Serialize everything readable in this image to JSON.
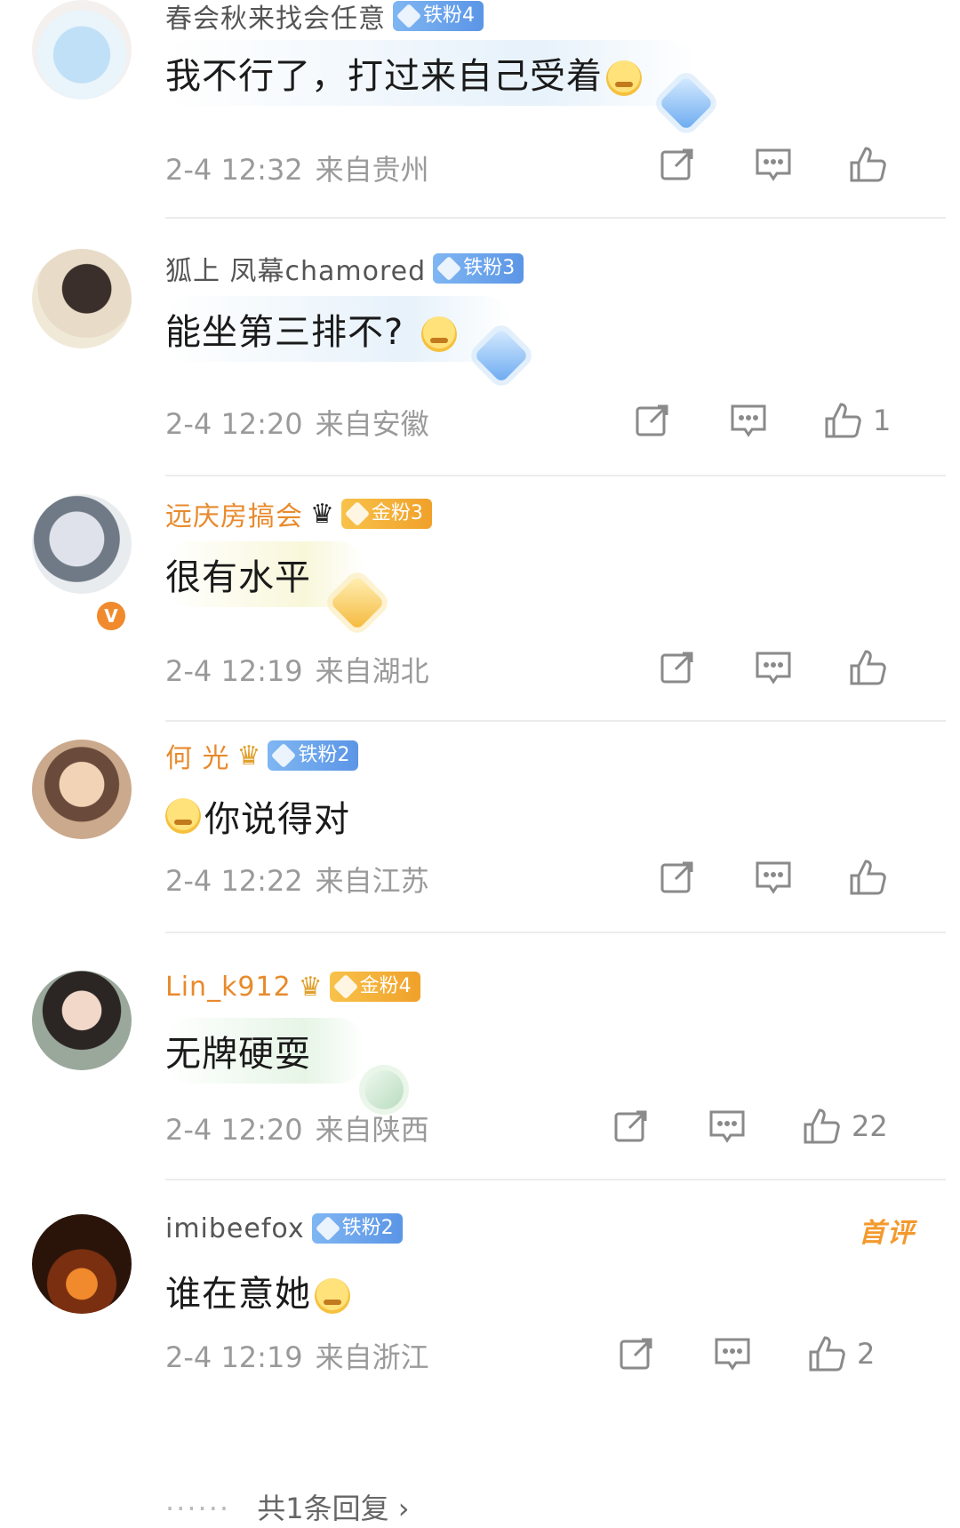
{
  "comments": [
    {
      "username": "春会秋来找会任意",
      "badge": "铁粉4",
      "text": "我不行了，打过来自己受着",
      "date": "2-4 12:32",
      "location": "来自贵州",
      "likes": ""
    },
    {
      "username": "狐上 凤幕chamored",
      "badge": "铁粉3",
      "text": "能坐第三排不?",
      "date": "2-4 12:20",
      "location": "来自安徽",
      "likes": "1"
    },
    {
      "username": "远庆房搞会",
      "badge": "金粉3",
      "text": "很有水平",
      "date": "2-4 12:19",
      "location": "来自湖北",
      "likes": ""
    },
    {
      "username": "何 光",
      "badge": "铁粉2",
      "text": "你说得对",
      "date": "2-4 12:22",
      "location": "来自江苏",
      "likes": ""
    },
    {
      "username": "Lin_k912",
      "badge": "金粉4",
      "text": "无牌硬耍",
      "date": "2-4 12:20",
      "location": "来自陕西",
      "likes": "22"
    },
    {
      "username": "imibeefox",
      "badge": "铁粉2",
      "text": "谁在意她",
      "date": "2-4 12:19",
      "location": "来自浙江",
      "likes": "2",
      "tag": "首评"
    }
  ],
  "footer": {
    "more_replies": "共1条回复 ›"
  },
  "colors": {
    "accent_orange": "#f08a2c",
    "iron_badge": "#5b95e6",
    "gold_badge": "#f0a12a",
    "meta_gray": "#9a9a9a"
  },
  "icons": [
    "share-icon",
    "comment-icon",
    "thumbs-up-icon",
    "verified-icon",
    "crown-icon",
    "diamond-icon"
  ]
}
